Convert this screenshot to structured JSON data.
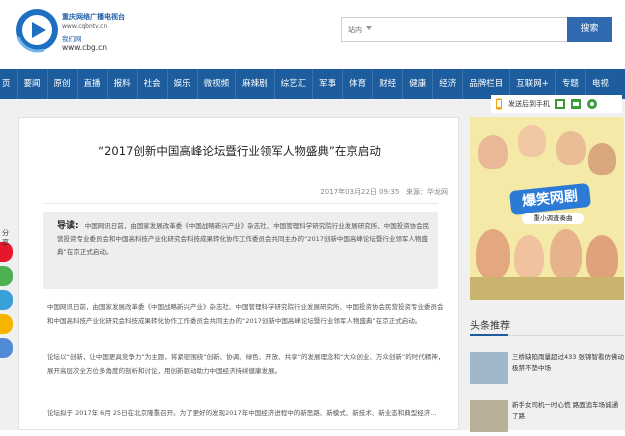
{
  "header": {
    "logo": {
      "title": "重庆网络广播电视台",
      "site": "www.cqbntv.cn",
      "sub": "我们网",
      "domain": "www.cbg.cn"
    },
    "search": {
      "scope": "站内",
      "button": "搜索"
    }
  },
  "nav": {
    "items": [
      "页",
      "要闻",
      "原创",
      "直播",
      "报料",
      "社会",
      "娱乐",
      "微视频",
      "麻辣剧",
      "综艺汇",
      "军事",
      "体育",
      "财经",
      "健康",
      "经济",
      "品牌栏目",
      "互联网+",
      "专题",
      "电视"
    ]
  },
  "toolbar": {
    "send_label": "发送后到手机"
  },
  "share": {
    "label": "分享"
  },
  "article": {
    "title": "“2017创新中国高峰论坛暨行业领军人物盛典”在京启动",
    "date": "2017年03月22日 09:35",
    "source": "来源：华龙网",
    "lead_label": "导读:",
    "lead_text": "中国网讯日前，由国家发展改革委《中国战略新兴产业》杂志社、中国管理科学研究院行业发展研究所、中国投资协会民营投资专业委员会和中国高科技产业化研究会科技成果转化协作工作委员会共同主办的“2017创新中国高峰论坛暨行业领军人物盛典”在京正式启动。",
    "paragraphs": [
      "中国网讯日前，由国家发展改革委《中国战略新兴产业》杂志社、中国管理科学研究院行业发展研究所、中国投资协会民营投资专业委员会和中国高科技产业化研究会科技成果转化协作工作委员会共同主办的“2017创新中国高峰论坛暨行业领军人物盛典”在京正式启动。",
      "论坛以“创新，让中国更具竞争力”为主题，将紧密围绕“创新、协调、绿色、开放、共享”的发展理念和“大众创业、万众创新”的时代精神，展开高层次全方位多角度的剖析和讨论，用创新驱动助力中国经济持续健康发展。",
      "论坛拟于 2017年 6月 25日在北京隆重召开。为了更好的发现2017年中国经济进程中的新思路、新模式、新技术、新业态和典型经济…"
    ]
  },
  "ad": {
    "title": "爆笑网剧",
    "sub": "重小调查奏曲"
  },
  "sidebar": {
    "section_title": "头条推荐",
    "news": [
      {
        "text": "三桥缺陷雨量超过433 张锦智看仿佛动极禁不垫中场"
      },
      {
        "text": "新手女司机一时心慌 路面追车场诚通了路"
      }
    ]
  }
}
